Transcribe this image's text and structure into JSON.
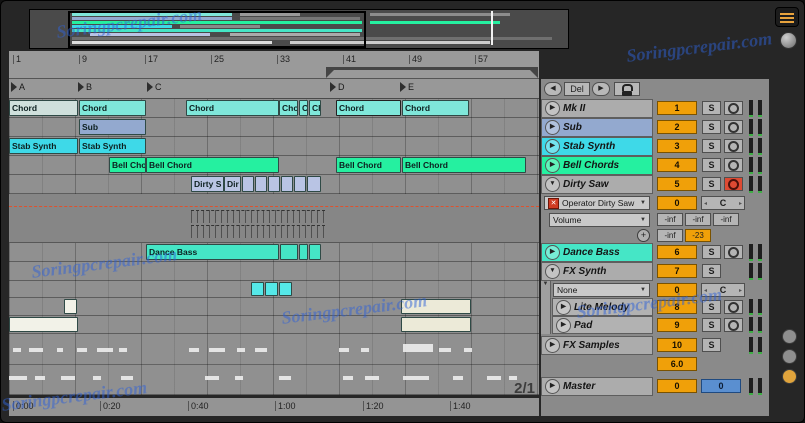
{
  "watermark": {
    "text": "Soringpcrepair.com"
  },
  "labels": {
    "solo": "S",
    "del": "Del",
    "c": "C",
    "zoom": "2/1"
  },
  "icons": {
    "fold_open": "▼",
    "fold_closed": "▶",
    "dropdown": "▼",
    "hotswap_x": "✕",
    "add": "+",
    "prev": "◀",
    "next": "▶",
    "arrow_l": "◂",
    "arrow_r": "▸"
  },
  "timeline": {
    "bars": [
      "1",
      "9",
      "17",
      "25",
      "33",
      "41",
      "49",
      "57"
    ],
    "times": [
      "0:00",
      "0:20",
      "0:40",
      "1:00",
      "1:20",
      "1:40"
    ],
    "locators": [
      "A",
      "B",
      "C",
      "D",
      "E"
    ]
  },
  "clip_labels": {
    "chord": "Chord",
    "sub": "Sub",
    "stab": "Stab Synth",
    "bell": "Bell Chord",
    "dirty_s": "Dirty S",
    "dir": "Dir",
    "dance": "Dance Bass"
  },
  "tracks": [
    {
      "name": "Mk II",
      "num": "1"
    },
    {
      "name": "Sub",
      "num": "2"
    },
    {
      "name": "Stab Synth",
      "num": "3"
    },
    {
      "name": "Bell Chords",
      "num": "4"
    },
    {
      "name": "Dirty Saw",
      "num": "5"
    },
    {
      "name": "Dance Bass",
      "num": "6"
    },
    {
      "name": "FX Synth",
      "num": "7"
    },
    {
      "name": "Lite Melody",
      "num": "8"
    },
    {
      "name": "Pad",
      "num": "9"
    },
    {
      "name": "FX Samples",
      "num": "10"
    },
    {
      "name": "Master"
    }
  ],
  "devices": {
    "dirty_saw": {
      "chooser": "Operator Dirty Saw",
      "param": "Volume",
      "gain": "0",
      "neg_inf": "-inf",
      "value": "-23"
    },
    "fx_synth": {
      "chooser": "None",
      "gain": "0"
    }
  },
  "mixer": {
    "fx_samples_gain": "6.0",
    "master_volume": "0",
    "master_pan": "0"
  }
}
